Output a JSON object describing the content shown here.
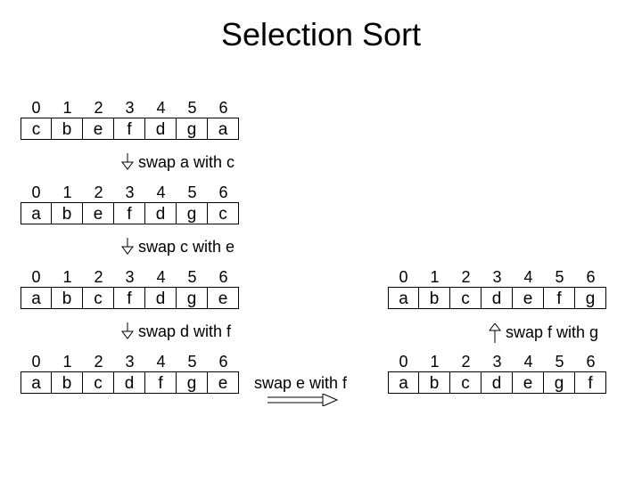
{
  "title": "Selection Sort",
  "arrays": {
    "a0": {
      "idx": [
        "0",
        "1",
        "2",
        "3",
        "4",
        "5",
        "6"
      ],
      "val": [
        "c",
        "b",
        "e",
        "f",
        "d",
        "g",
        "a"
      ]
    },
    "a1": {
      "idx": [
        "0",
        "1",
        "2",
        "3",
        "4",
        "5",
        "6"
      ],
      "val": [
        "a",
        "b",
        "e",
        "f",
        "d",
        "g",
        "c"
      ]
    },
    "a2": {
      "idx": [
        "0",
        "1",
        "2",
        "3",
        "4",
        "5",
        "6"
      ],
      "val": [
        "a",
        "b",
        "c",
        "f",
        "d",
        "g",
        "e"
      ]
    },
    "a3": {
      "idx": [
        "0",
        "1",
        "2",
        "3",
        "4",
        "5",
        "6"
      ],
      "val": [
        "a",
        "b",
        "c",
        "d",
        "f",
        "g",
        "e"
      ]
    },
    "a4": {
      "idx": [
        "0",
        "1",
        "2",
        "3",
        "4",
        "5",
        "6"
      ],
      "val": [
        "a",
        "b",
        "c",
        "d",
        "e",
        "g",
        "f"
      ]
    },
    "a5": {
      "idx": [
        "0",
        "1",
        "2",
        "3",
        "4",
        "5",
        "6"
      ],
      "val": [
        "a",
        "b",
        "c",
        "d",
        "e",
        "f",
        "g"
      ]
    }
  },
  "swaps": {
    "s1": "swap a with c",
    "s2": "swap c with e",
    "s3": "swap d with f",
    "s4": "swap e with f",
    "s5": "swap f with g"
  }
}
